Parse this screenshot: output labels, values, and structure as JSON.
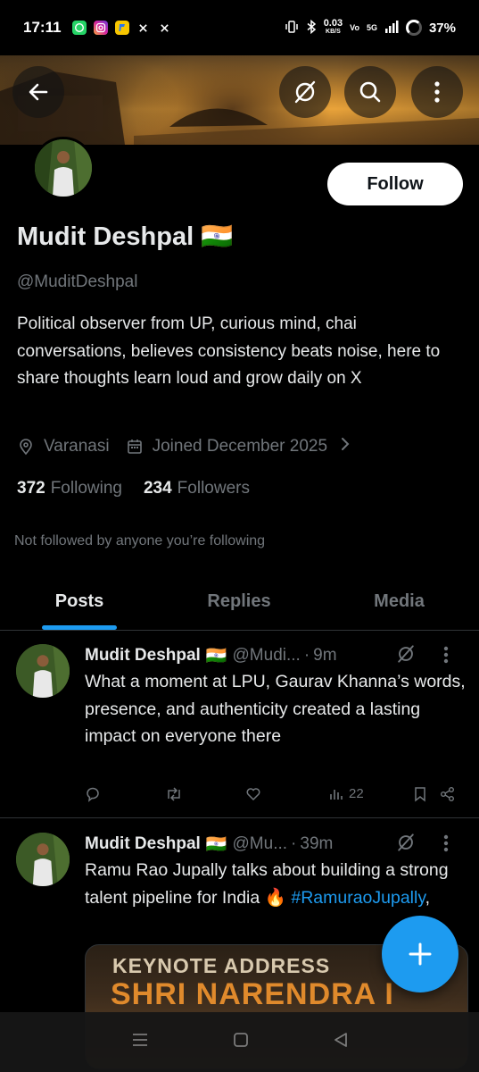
{
  "status_bar": {
    "time": "17:11",
    "apps": [
      {
        "icon": "whatsapp-icon",
        "color": "#25d366"
      },
      {
        "icon": "instagram-icon",
        "color": "#d6249f"
      },
      {
        "icon": "flipkart-icon",
        "color": "#f7c600"
      },
      {
        "icon": "x-icon",
        "color": "#000000"
      },
      {
        "icon": "x-icon",
        "color": "#000000"
      }
    ],
    "net_speed": "0.03",
    "net_unit": "KB/S",
    "volte": "Vo",
    "network": "5G",
    "battery": "37%"
  },
  "banner": {
    "back_icon": "back-arrow-icon",
    "grok_icon": "grok-icon",
    "search_icon": "search-icon",
    "more_icon": "more-vertical-icon"
  },
  "profile": {
    "display_name": "Mudit Deshpal",
    "flag": "🇮🇳",
    "handle": "@MuditDeshpal",
    "bio": "Political observer from UP, curious mind, chai conversations, believes consistency beats noise, here to share thoughts learn loud and grow daily on X",
    "location": "Varanasi",
    "joined": "Joined December 2025",
    "following_count": "372",
    "following_label": "Following",
    "followers_count": "234",
    "followers_label": "Followers",
    "not_followed_text": "Not followed by anyone you’re following",
    "follow_label": "Follow"
  },
  "tabs": [
    {
      "label": "Posts",
      "active": true
    },
    {
      "label": "Replies",
      "active": false
    },
    {
      "label": "Media",
      "active": false
    }
  ],
  "posts": [
    {
      "name": "Mudit Deshpal",
      "flag": "🇮🇳",
      "handle": "@Mudi...",
      "dot": "·",
      "time": "9m",
      "text": "What a moment at LPU, Gaurav Khanna’s words, presence, and authenticity created a lasting impact on everyone there",
      "views": "22"
    },
    {
      "name": "Mudit Deshpal",
      "flag": "🇮🇳",
      "handle": "@Mu...",
      "dot": "·",
      "time": "39m",
      "text_main": "Ramu Rao Jupally talks about building a strong talent pipeline for India 🔥",
      "hashtag": "#RamuraoJupally",
      "text_tail": ",",
      "media_line1": "KEYNOTE ADDRESS",
      "media_line2": "SHRI NARENDRA I"
    }
  ],
  "colors": {
    "accent": "#1d9bf0",
    "text_primary": "#e7e9ea",
    "text_secondary": "#71767b",
    "background": "#000000",
    "divider": "#2f3336"
  }
}
